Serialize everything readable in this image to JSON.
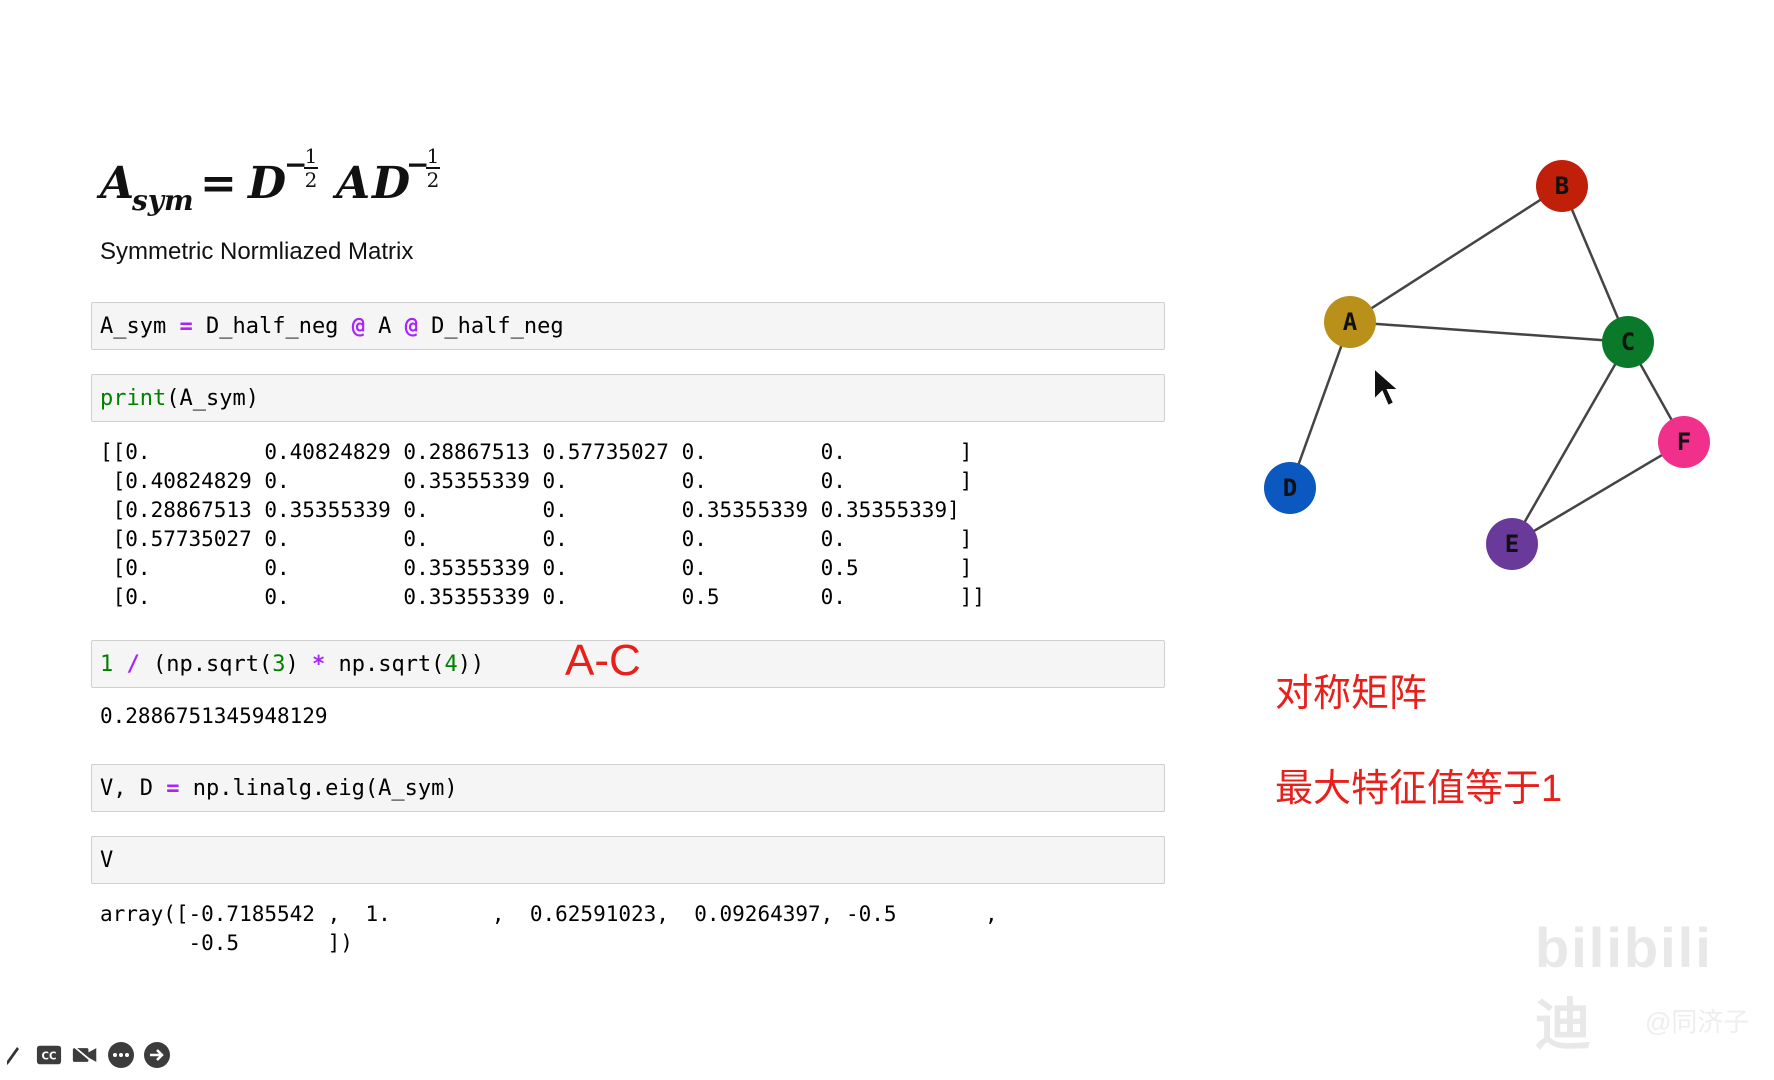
{
  "formula": {
    "A": "A",
    "sym": "sym",
    "eq": "=",
    "D": "D",
    "A2": "A",
    "exp_num": "1",
    "exp_den": "2",
    "minus": "−"
  },
  "description": "Symmetric Normliazed Matrix",
  "cells": {
    "c1": {
      "part1": "A_sym ",
      "op1": "=",
      "part2": " D_half_neg ",
      "op2": "@",
      "part3": " A ",
      "op3": "@",
      "part4": " D_half_neg"
    },
    "c2": {
      "fn": "print",
      "args": "(A_sym)"
    },
    "c3": {
      "n1": "1",
      "op1": " / ",
      "p1": "(np.sqrt(",
      "n2": "3",
      "p2": ") ",
      "op2": "*",
      "p3": " np.sqrt(",
      "n3": "4",
      "p4": "))"
    },
    "c4": {
      "part1": "V, D ",
      "op": "=",
      "part2": " np.linalg.eig(A_sym)"
    },
    "c5": {
      "code": "V"
    }
  },
  "outputs": {
    "matrix": "[[0.         0.40824829 0.28867513 0.57735027 0.         0.         ]\n [0.40824829 0.         0.35355339 0.         0.         0.         ]\n [0.28867513 0.35355339 0.         0.         0.35355339 0.35355339]\n [0.57735027 0.         0.         0.         0.         0.         ]\n [0.         0.         0.35355339 0.         0.         0.5        ]\n [0.         0.         0.35355339 0.         0.5        0.         ]]",
    "value": "0.2886751345948129",
    "array": "array([-0.7185542 ,  1.        ,  0.62591023,  0.09264397, -0.5       ,\n       -0.5       ])"
  },
  "notes": {
    "ac": "A-C",
    "symmetric": "对称矩阵",
    "eigen": "最大特征值等于1"
  },
  "graph": {
    "nodes": [
      {
        "id": "A",
        "color": "#b8901a"
      },
      {
        "id": "B",
        "color": "#c0200a"
      },
      {
        "id": "C",
        "color": "#0a7a2a"
      },
      {
        "id": "D",
        "color": "#0a58c0"
      },
      {
        "id": "E",
        "color": "#6a3a9a"
      },
      {
        "id": "F",
        "color": "#f0308a"
      }
    ],
    "edges": [
      [
        "A",
        "B"
      ],
      [
        "A",
        "C"
      ],
      [
        "A",
        "D"
      ],
      [
        "B",
        "C"
      ],
      [
        "C",
        "E"
      ],
      [
        "C",
        "F"
      ],
      [
        "E",
        "F"
      ]
    ]
  },
  "toolbar": {
    "icons": [
      "edit-icon",
      "cc-icon",
      "video-off-icon",
      "more-icon",
      "next-icon"
    ],
    "cc_label": "CC"
  },
  "colors": {
    "accent_red": "#e8201c",
    "operator": "#aa22ff",
    "builtin": "#008000"
  },
  "watermark": {
    "logo": "bilibili 迪",
    "sub": "@同济子"
  }
}
